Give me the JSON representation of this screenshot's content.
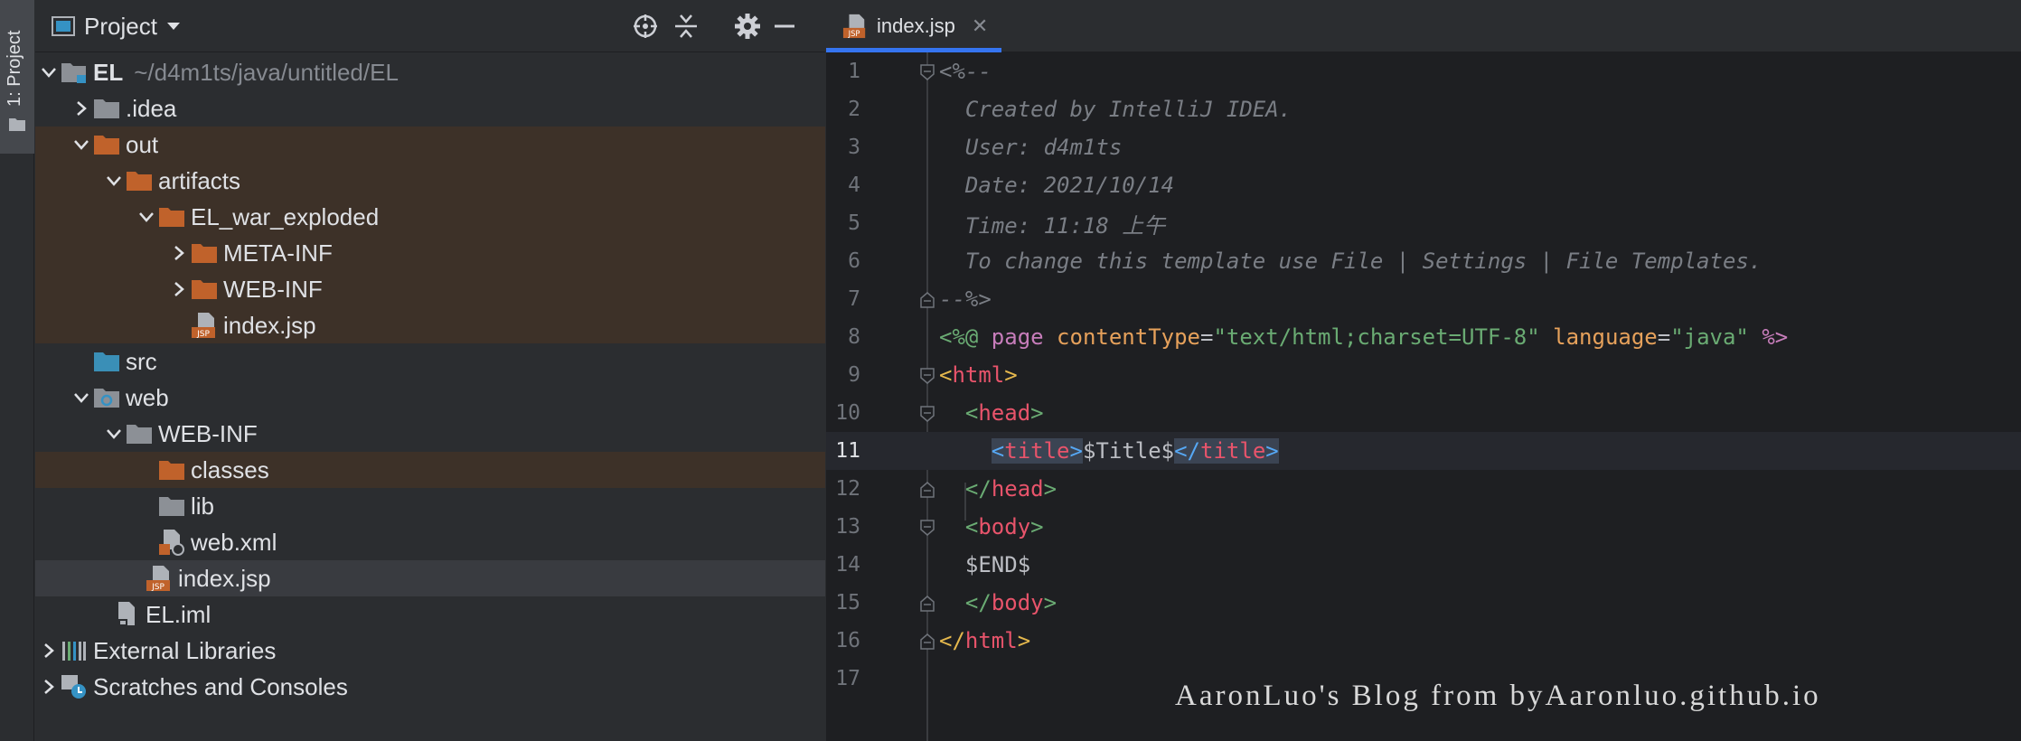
{
  "stripe": {
    "label": "1: Project"
  },
  "project": {
    "title": "Project",
    "tree": [
      {
        "label": "EL",
        "path": "~/d4m1ts/java/untitled/EL"
      },
      {
        "label": ".idea"
      },
      {
        "label": "out"
      },
      {
        "label": "artifacts"
      },
      {
        "label": "EL_war_exploded"
      },
      {
        "label": "META-INF"
      },
      {
        "label": "WEB-INF"
      },
      {
        "label": "index.jsp"
      },
      {
        "label": "src"
      },
      {
        "label": "web"
      },
      {
        "label": "WEB-INF"
      },
      {
        "label": "classes"
      },
      {
        "label": "lib"
      },
      {
        "label": "web.xml"
      },
      {
        "label": "index.jsp"
      },
      {
        "label": "EL.iml"
      },
      {
        "label": "External Libraries"
      },
      {
        "label": "Scratches and Consoles"
      }
    ]
  },
  "editor": {
    "tab": {
      "label": "index.jsp",
      "close": "✕"
    },
    "line_numbers": [
      "1",
      "2",
      "3",
      "4",
      "5",
      "6",
      "7",
      "8",
      "9",
      "10",
      "11",
      "12",
      "13",
      "14",
      "15",
      "16",
      "17"
    ],
    "code": {
      "l1": "<%--",
      "l2": "  Created by IntelliJ IDEA.",
      "l3": "  User: d4m1ts",
      "l4": "  Date: 2021/10/14",
      "l5": "  Time: 11:18 上午",
      "l6": "  To change this template use File | Settings | File Templates.",
      "l7": "--%>",
      "l8": {
        "open": "<%@ ",
        "kw": "page",
        "a1": "contentType",
        "eq1": "=",
        "v1": "\"text/html;charset=UTF-8\"",
        "a2": "language",
        "eq2": "=",
        "v2": "\"java\"",
        "close": "%>"
      },
      "l9": {
        "lt": "<",
        "tag": "html",
        "gt": ">"
      },
      "l10": {
        "lt": "<",
        "tag": "head",
        "gt": ">"
      },
      "l11": {
        "lt": "<",
        "tag": "title",
        "gt": ">",
        "text": "$Title$",
        "clt": "</",
        "ctag": "title",
        "cgt": ">"
      },
      "l12": {
        "lt": "</",
        "tag": "head",
        "gt": ">"
      },
      "l13": {
        "lt": "<",
        "tag": "body",
        "gt": ">"
      },
      "l14": "$END$",
      "l15": {
        "lt": "</",
        "tag": "body",
        "gt": ">"
      },
      "l16": {
        "lt": "</",
        "tag": "html",
        "gt": ">"
      }
    }
  },
  "watermark": "AaronLuo's Blog from byAaronluo.github.io",
  "colors": {
    "folder": "#c0622b",
    "folder_gray": "#8c9096",
    "folder_src": "#3a8fb7",
    "excluded_bg": "#3d3128",
    "accent": "#3574f0"
  }
}
